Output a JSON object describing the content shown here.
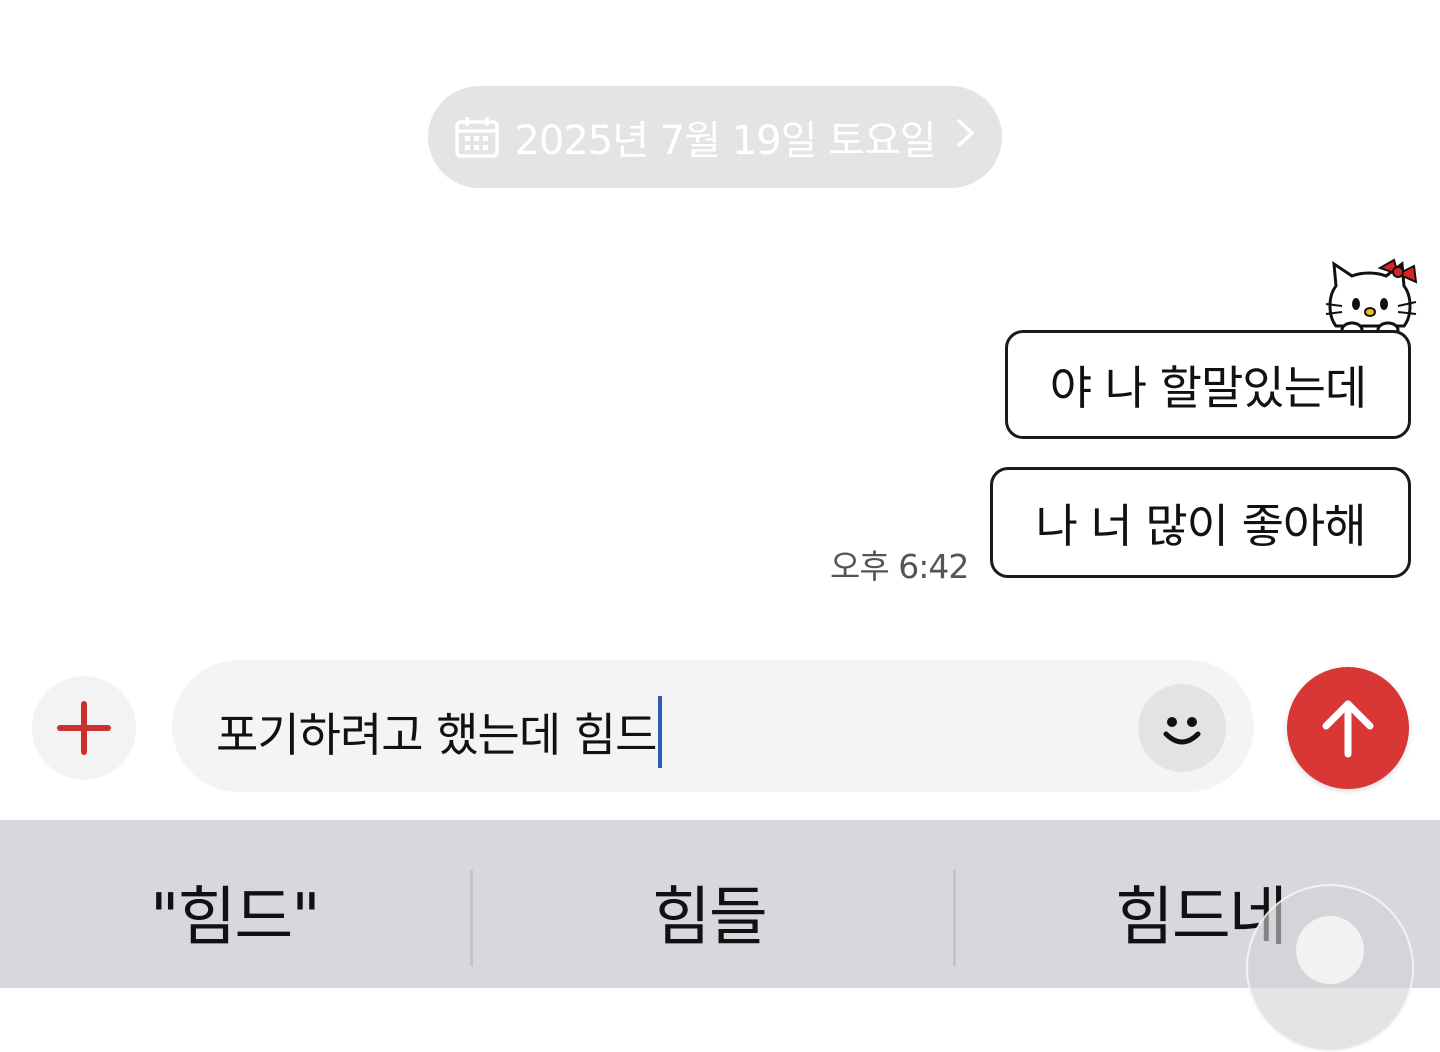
{
  "date_pill": {
    "text": "2025년 7월 19일 토요일",
    "icon": "calendar-icon",
    "chevron": "chevron-right-icon"
  },
  "messages": [
    {
      "text": "야 나 할말있는데"
    },
    {
      "text": "나 너 많이 좋아해"
    }
  ],
  "timestamp": "오후 6:42",
  "composer": {
    "input_value": "포기하려고 했는데 힘드",
    "plus_icon": "plus-icon",
    "emoji_icon": "smiley-icon",
    "send_icon": "arrow-up-icon"
  },
  "keyboard_suggestions": [
    "\"힘드\"",
    "힘들",
    "힘드네"
  ],
  "colors": {
    "send_button": "#d93636",
    "plus_icon": "#c93030",
    "date_pill_bg": "#e4e4e6",
    "keyboard_bg": "#d7d8de",
    "caret": "#2e5bb8"
  }
}
